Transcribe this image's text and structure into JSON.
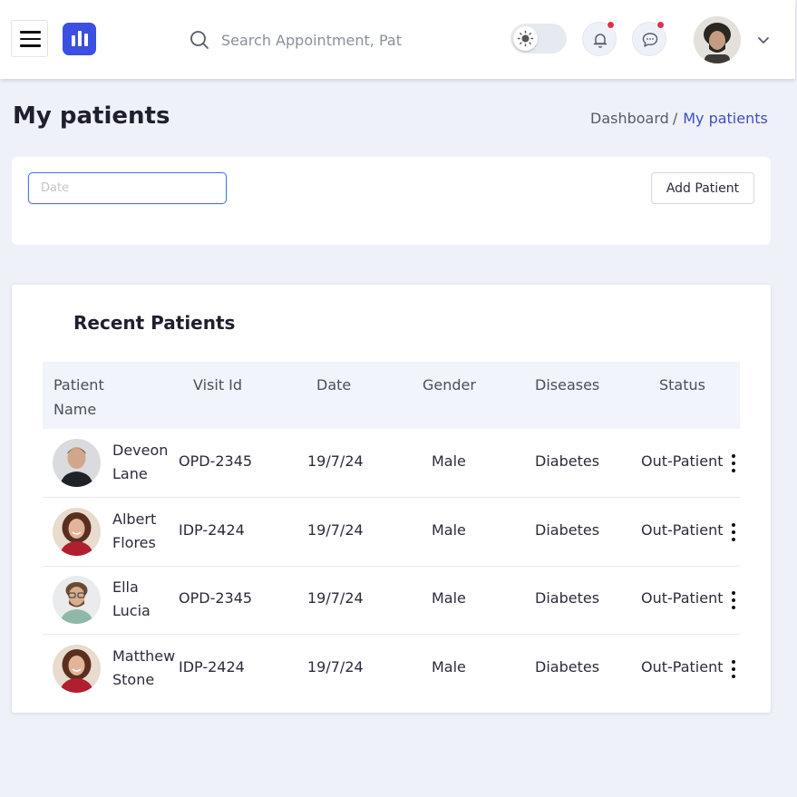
{
  "header": {
    "search_placeholder": "Search Appointment, Pat",
    "notifications_badge": true,
    "messages_badge": true
  },
  "page": {
    "title": "My patients",
    "breadcrumb": {
      "home": "Dashboard",
      "separator": "/",
      "current": "My patients"
    }
  },
  "filter": {
    "date_placeholder": "Date",
    "add_button": "Add Patient"
  },
  "recent": {
    "title": "Recent Patients",
    "columns": {
      "name_line1": "Patient",
      "name_line2": "Name",
      "visit_id": "Visit Id",
      "date": "Date",
      "gender": "Gender",
      "diseases": "Diseases",
      "status": "Status"
    },
    "rows": [
      {
        "first": "Deveon",
        "last": "Lane",
        "visit_id": "OPD-2345",
        "date": "19/7/24",
        "gender": "Male",
        "disease": "Diabetes",
        "status": "Out-Patient",
        "avatar": "man-avatar"
      },
      {
        "first": "Albert",
        "last": "Flores",
        "visit_id": "IDP-2424",
        "date": "19/7/24",
        "gender": "Male",
        "disease": "Diabetes",
        "status": "Out-Patient",
        "avatar": "woman-avatar"
      },
      {
        "first": "Ella",
        "last": "Lucia",
        "visit_id": "OPD-2345",
        "date": "19/7/24",
        "gender": "Male",
        "disease": "Diabetes",
        "status": "Out-Patient",
        "avatar": "bearded-man-avatar"
      },
      {
        "first": "Matthew",
        "last": "Stone",
        "visit_id": "IDP-2424",
        "date": "19/7/24",
        "gender": "Male",
        "disease": "Diabetes",
        "status": "Out-Patient",
        "avatar": "woman-avatar"
      }
    ]
  },
  "colors": {
    "accent": "#3b4fe0",
    "breadcrumb_active": "#3f4fc4",
    "badge": "#e0304a",
    "background": "#eef1f7"
  }
}
